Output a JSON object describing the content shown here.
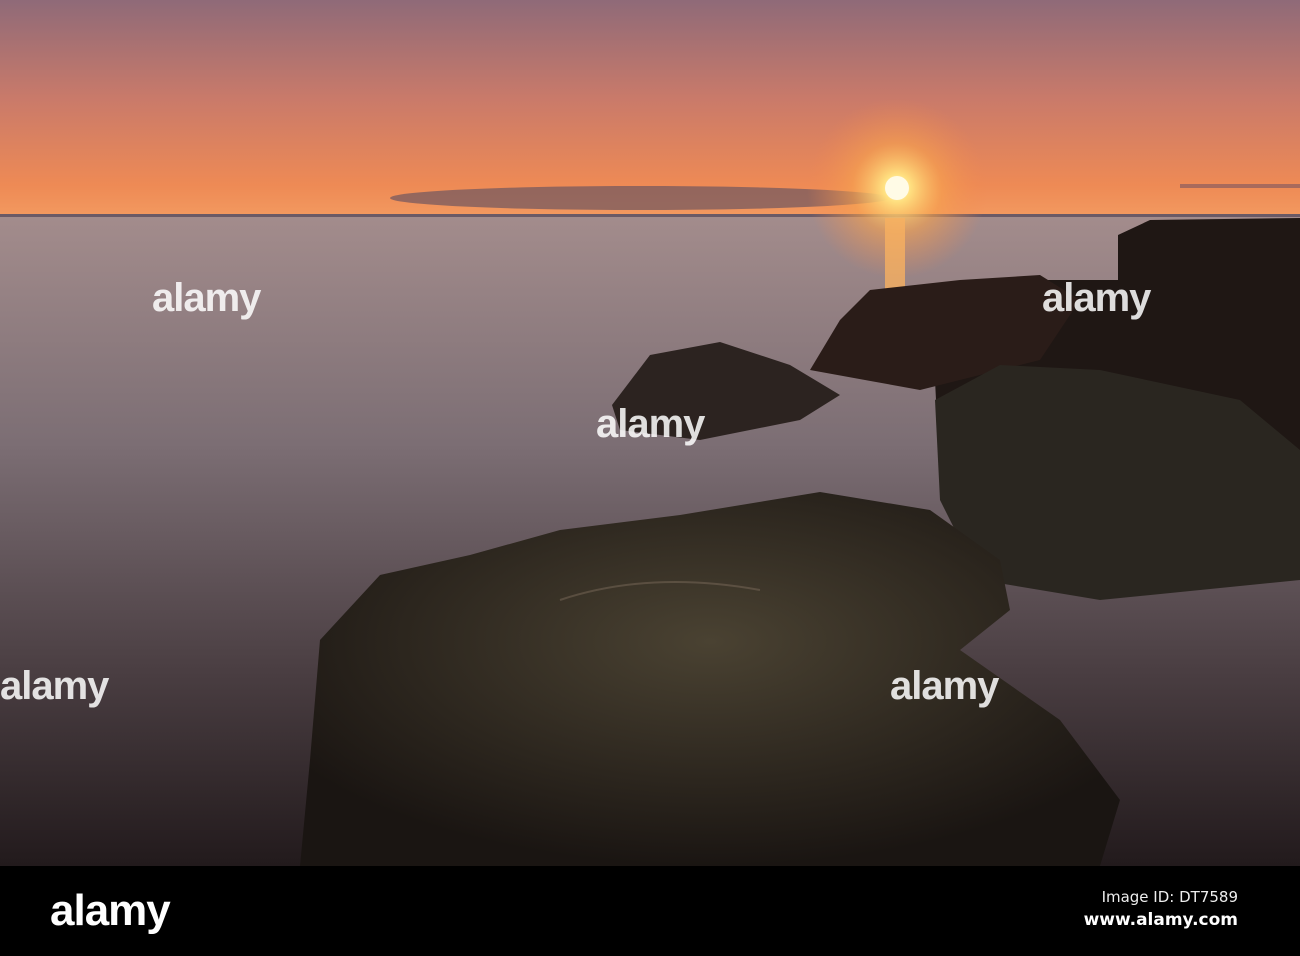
{
  "photo": {
    "subject": "sunset over sea with rocks",
    "colors": {
      "sky_top": "#8f6a78",
      "sky_horizon": "#f08850",
      "sun": "#fff6c8",
      "sea": "#8a7c84",
      "rock": "#1e1816"
    }
  },
  "watermark": {
    "text": "alamy"
  },
  "footer": {
    "logo": "alamy",
    "image_id": "Image ID: DT7589",
    "url": "www.alamy.com"
  }
}
